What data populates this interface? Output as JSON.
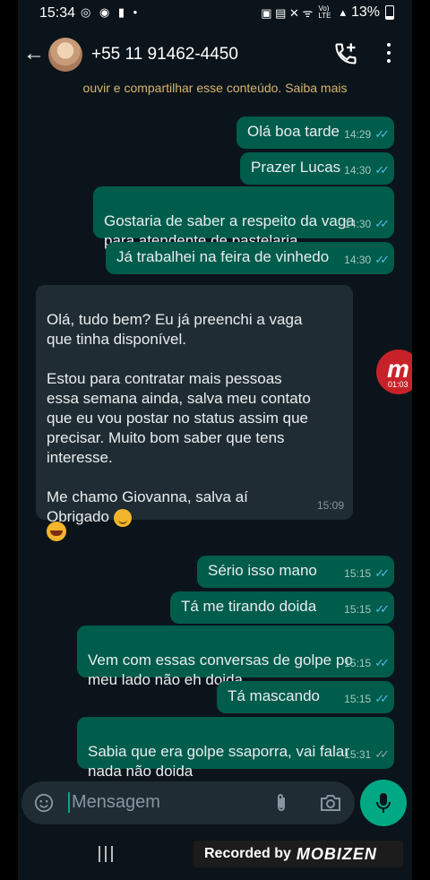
{
  "status_bar": {
    "time": "15:34",
    "left_icons": "◎ ◉ ▮ •",
    "right_icons": "▣ ▤ ✕ ᯤ",
    "network": "Vo) LTE",
    "battery": "13%"
  },
  "header": {
    "contact_name": "+55 11 91462-4450"
  },
  "chat": {
    "notice": "ouvir e compartilhar esse conteúdo. Saiba mais",
    "messages": [
      {
        "text": "Olá boa tarde",
        "time": "14:29"
      },
      {
        "text": "Prazer Lucas",
        "time": "14:30"
      },
      {
        "text": "Gostaria de saber a respeito da vaga\npara atendente de pastelaria",
        "time": "14:30"
      },
      {
        "text": "Já trabalhei na feira de vinhedo",
        "time": "14:30"
      },
      {
        "text": "Olá, tudo bem? Eu já preenchi a vaga\nque tinha disponível.\n\nEstou para contratar mais pessoas\nessa semana ainda, salva meu contato\nque eu vou postar no status assim que\nprecisar. Muito bom saber que tens\ninteresse.\n\nMe chamo Giovanna, salva aí\nObrigado",
        "time": "15:09"
      },
      {
        "text": "Sério isso mano",
        "time": "15:15"
      },
      {
        "text": "Tá me tirando doida",
        "time": "15:15"
      },
      {
        "text": "Vem com essas conversas de golpe po\nmeu lado não eh doida",
        "time": "15:15"
      },
      {
        "text": "Tá mascando",
        "time": "15:15"
      },
      {
        "text": "Sabia que era golpe ssaporra,  vai falar\nnada não doida",
        "time": "15:31"
      }
    ]
  },
  "recording_overlay": {
    "letter": "m",
    "timer": "01:03"
  },
  "input": {
    "placeholder": "Mensagem"
  },
  "watermark": {
    "prefix": "Recorded by",
    "brand": "MOBIZEN"
  },
  "colors": {
    "outgoing": "#005c4b",
    "incoming": "#1f2c34",
    "accent": "#00a884",
    "read_ticks": "#53bdeb"
  }
}
